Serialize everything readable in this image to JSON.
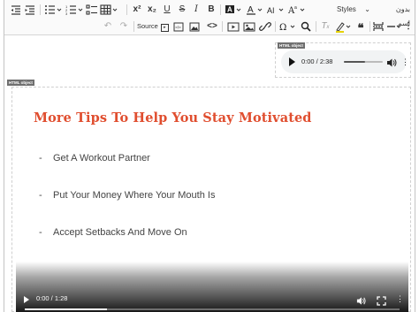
{
  "toolbar": {
    "styles_label": "Styles",
    "rtl_label": "بدون اسم",
    "source_label": "Source",
    "buttons_row1": [
      "outdent",
      "indent",
      "bulleted-list",
      "numbered-list",
      "check-list",
      "table",
      "superscript",
      "subscript",
      "underline",
      "strikethrough",
      "italic",
      "bold",
      "background-color",
      "font-color",
      "font-size",
      "font-family"
    ],
    "buttons_row2": [
      "undo",
      "redo",
      "source-editing",
      "insert-html",
      "code",
      "media",
      "image",
      "link",
      "special-characters",
      "find-replace",
      "remove-format",
      "highlight",
      "quote",
      "page-break",
      "horizontal-line",
      "more"
    ]
  },
  "audio_widget": {
    "label": "HTML object",
    "time": "0:00 / 2:38",
    "progress": 0.55
  },
  "html_widget": {
    "label": "HTML object",
    "heading": "More Tips To Help You Stay Motivated",
    "heading_color": "#e04e2f",
    "list_marker": "-",
    "items": [
      "Get A Workout Partner",
      "Put Your Money Where Your Mouth Is",
      "Accept Setbacks And Move On"
    ],
    "video_time": "0:00 / 1:28",
    "video_progress": 0.22
  }
}
